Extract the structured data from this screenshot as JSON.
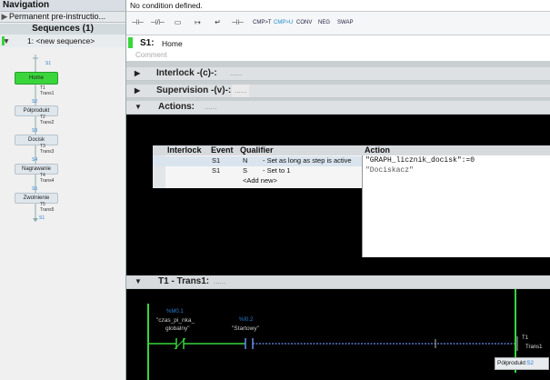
{
  "navigation": {
    "title": "Navigation",
    "permanent_row": "Permanent pre-instructio...",
    "sequences_header": "Sequences (1)",
    "sequence_item": "1: <new sequence>"
  },
  "sequence_graph": {
    "steps": [
      {
        "num": "S1",
        "name": "Home"
      },
      {
        "num": "S2",
        "name": "Półprodukt"
      },
      {
        "num": "S3",
        "name": "Docisk"
      },
      {
        "num": "S4",
        "name": "Nagrawanie"
      },
      {
        "num": "S5",
        "name": "Zwolnienie"
      }
    ],
    "transitions": [
      {
        "num": "T1",
        "name": "Trans1"
      },
      {
        "num": "T2",
        "name": "Trans2"
      },
      {
        "num": "T3",
        "name": "Trans3"
      },
      {
        "num": "T4",
        "name": "Trans4"
      },
      {
        "num": "T5",
        "name": "Trans5"
      }
    ],
    "jump_label": "S1",
    "active_color": "#39d53b"
  },
  "condition_bar": {
    "text": "No condition defined."
  },
  "toolbar": {
    "buttons": [
      {
        "label": "⊣⊢",
        "icon": "no-contact-icon"
      },
      {
        "label": "⊣/⊢",
        "icon": "nc-contact-icon"
      },
      {
        "label": "▭",
        "icon": "box-icon"
      },
      {
        "label": "↦",
        "icon": "open-branch-icon"
      },
      {
        "label": "↵",
        "icon": "close-branch-icon"
      },
      {
        "label": "⊣⊢",
        "icon": "contact2-icon"
      }
    ],
    "text_buttons": [
      "CMP>T",
      "CMP>U",
      "CONV",
      "NEG",
      "SWAP"
    ]
  },
  "step_header": {
    "number": "S1:",
    "name": "Home",
    "comment_placeholder": "Comment"
  },
  "sections": {
    "interlock": "Interlock  -(c)-:",
    "supervision": "Supervision  -(v)-:",
    "actions": "Actions:",
    "transition": "T1 - Trans1:",
    "dashes": "......"
  },
  "actions_table": {
    "headers": {
      "interlock": "Interlock",
      "event": "Event",
      "qualifier": "Qualifier",
      "action": "Action"
    },
    "rows": [
      {
        "event": "S1",
        "qualifier": "N",
        "qualifier_desc": "- Set as long as step is active",
        "action": "\"GRAPH_licznik_docisk\":=0"
      },
      {
        "event": "S1",
        "qualifier": "S",
        "qualifier_desc": "- Set to 1",
        "action": "\"Dociskacz\""
      }
    ],
    "add_new": "<Add new>"
  },
  "ladder": {
    "contact1": {
      "address": "%M0.1",
      "name_line1": "\"czas_pi_nka_",
      "name_line2": "globalny\""
    },
    "contact2": {
      "address": "%I0.2",
      "name_line1": "\"Startowy\""
    },
    "transition_label": "T1",
    "transition_name": "Trans1",
    "next_step_name": "Półprodukt",
    "next_step_num": "S2"
  }
}
